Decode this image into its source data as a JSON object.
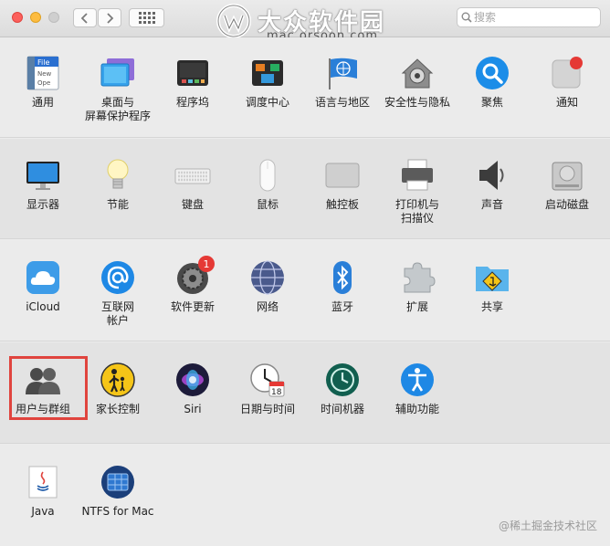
{
  "titlebar": {
    "watermark_title": "大众软件园",
    "watermark_sub": "mac.orsoon.com",
    "search_placeholder": "搜索"
  },
  "sections": [
    [
      {
        "id": "general",
        "label": "通用",
        "icon": "file-doc-icon"
      },
      {
        "id": "desktop",
        "label": "桌面与\n屏幕保护程序",
        "icon": "desktop-screensaver-icon"
      },
      {
        "id": "dock",
        "label": "程序坞",
        "icon": "dock-icon"
      },
      {
        "id": "mission",
        "label": "调度中心",
        "icon": "mission-control-icon"
      },
      {
        "id": "language",
        "label": "语言与地区",
        "icon": "flag-globe-icon"
      },
      {
        "id": "security",
        "label": "安全性与隐私",
        "icon": "house-lock-icon"
      },
      {
        "id": "spotlight",
        "label": "聚焦",
        "icon": "magnifier-icon"
      },
      {
        "id": "notifications",
        "label": "通知",
        "icon": "notification-icon"
      }
    ],
    [
      {
        "id": "displays",
        "label": "显示器",
        "icon": "monitor-icon"
      },
      {
        "id": "energy",
        "label": "节能",
        "icon": "lightbulb-icon"
      },
      {
        "id": "keyboard",
        "label": "键盘",
        "icon": "keyboard-icon"
      },
      {
        "id": "mouse",
        "label": "鼠标",
        "icon": "mouse-icon"
      },
      {
        "id": "trackpad",
        "label": "触控板",
        "icon": "trackpad-icon"
      },
      {
        "id": "printers",
        "label": "打印机与\n扫描仪",
        "icon": "printer-icon"
      },
      {
        "id": "sound",
        "label": "声音",
        "icon": "speaker-icon"
      },
      {
        "id": "startup",
        "label": "启动磁盘",
        "icon": "hard-disk-icon"
      }
    ],
    [
      {
        "id": "icloud",
        "label": "iCloud",
        "icon": "cloud-icon"
      },
      {
        "id": "internet",
        "label": "互联网\n帐户",
        "icon": "at-sign-icon"
      },
      {
        "id": "update",
        "label": "软件更新",
        "icon": "gear-update-icon",
        "badge": "1"
      },
      {
        "id": "network",
        "label": "网络",
        "icon": "network-globe-icon"
      },
      {
        "id": "bluetooth",
        "label": "蓝牙",
        "icon": "bluetooth-icon"
      },
      {
        "id": "extensions",
        "label": "扩展",
        "icon": "puzzle-icon"
      },
      {
        "id": "sharing",
        "label": "共享",
        "icon": "sharing-folder-icon"
      }
    ],
    [
      {
        "id": "users",
        "label": "用户与群组",
        "icon": "users-icon"
      },
      {
        "id": "parental",
        "label": "家长控制",
        "icon": "parental-control-icon"
      },
      {
        "id": "siri",
        "label": "Siri",
        "icon": "siri-icon"
      },
      {
        "id": "datetime",
        "label": "日期与时间",
        "icon": "clock-calendar-icon"
      },
      {
        "id": "timemachine",
        "label": "时间机器",
        "icon": "time-machine-icon"
      },
      {
        "id": "accessibility",
        "label": "辅助功能",
        "icon": "accessibility-icon"
      }
    ],
    [
      {
        "id": "java",
        "label": "Java",
        "icon": "java-icon"
      },
      {
        "id": "ntfs",
        "label": "NTFS for Mac",
        "icon": "ntfs-drive-icon"
      }
    ]
  ],
  "icon_text": {
    "file_line1": "File",
    "file_line2": "New",
    "file_line3": "Ope",
    "calendar_day": "18",
    "update_badge": "1"
  },
  "footer_watermark": "@稀土掘金技术社区",
  "colors": {
    "highlight": "#e0443e",
    "accent_blue": "#1e88e5"
  }
}
